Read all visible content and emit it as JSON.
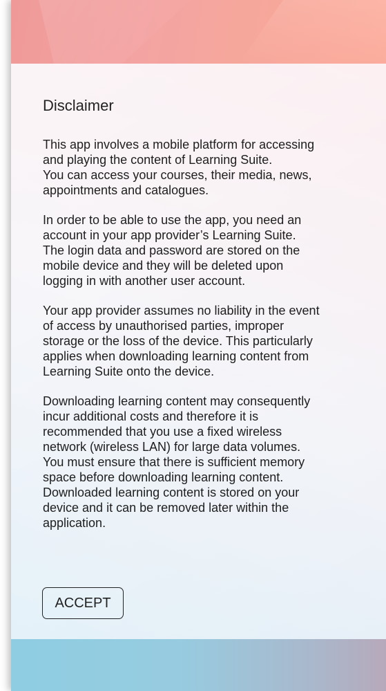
{
  "disclaimer": {
    "title": "Disclaimer",
    "paragraphs": [
      "This app involves a mobile platform for accessing\nand playing the content of Learning Suite.\nYou can access your courses, their media, news,\nappointments and catalogues.",
      "In order to be able to use the app, you need an\naccount in your app provider’s Learning Suite.\nThe login data and password are stored on the\nmobile device and they will be deleted upon\nlogging in with another user account.",
      "Your app provider assumes no liability in the event\nof access by unauthorised parties, improper\nstorage or the loss of the device. This particularly\napplies when downloading learning content from\nLearning Suite onto the device.",
      "Downloading learning content may consequently\nincur additional costs and therefore it is\nrecommended that you use a fixed wireless\nnetwork (wireless LAN) for large data volumes.\nYou must ensure that there is sufficient memory\nspace before downloading learning content.\nDownloaded learning content is stored on your\ndevice and it can be removed later within the\napplication."
    ]
  },
  "actions": {
    "accept_label": "ACCEPT"
  },
  "colors": {
    "header_band": "#f3a3a2",
    "footer_band": "#97cbe0",
    "text": "#1e1e1e"
  }
}
